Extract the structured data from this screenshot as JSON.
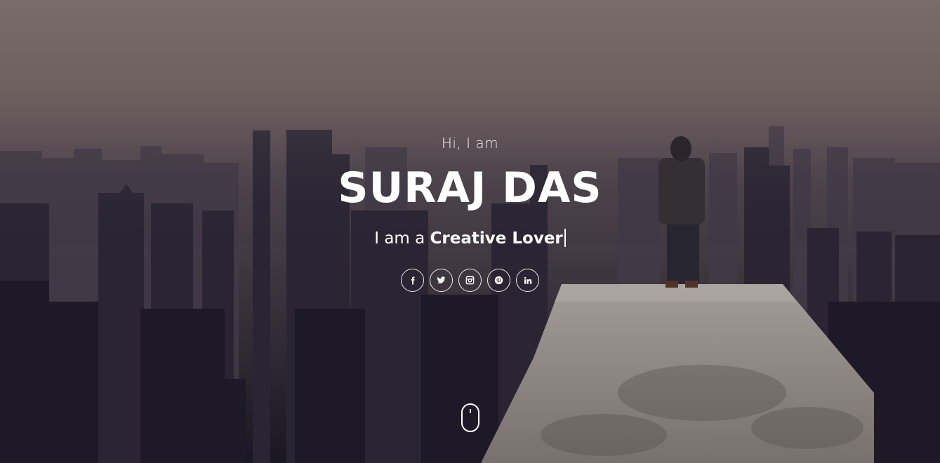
{
  "hero": {
    "greeting": "Hi, I am",
    "name": "SURAJ DAS",
    "tagline_prefix": "I am a",
    "tagline_role": "Creative Lover"
  },
  "socials": [
    {
      "name": "facebook",
      "icon": "facebook-icon"
    },
    {
      "name": "twitter",
      "icon": "twitter-icon"
    },
    {
      "name": "instagram",
      "icon": "instagram-icon"
    },
    {
      "name": "pinterest",
      "icon": "pinterest-icon"
    },
    {
      "name": "linkedin",
      "icon": "linkedin-icon"
    }
  ],
  "scroll_indicator": {
    "icon": "mouse-scroll-icon"
  },
  "colors": {
    "text": "#ffffff",
    "sky_top": "#8d7e79",
    "city_dark": "#1d1b26"
  }
}
